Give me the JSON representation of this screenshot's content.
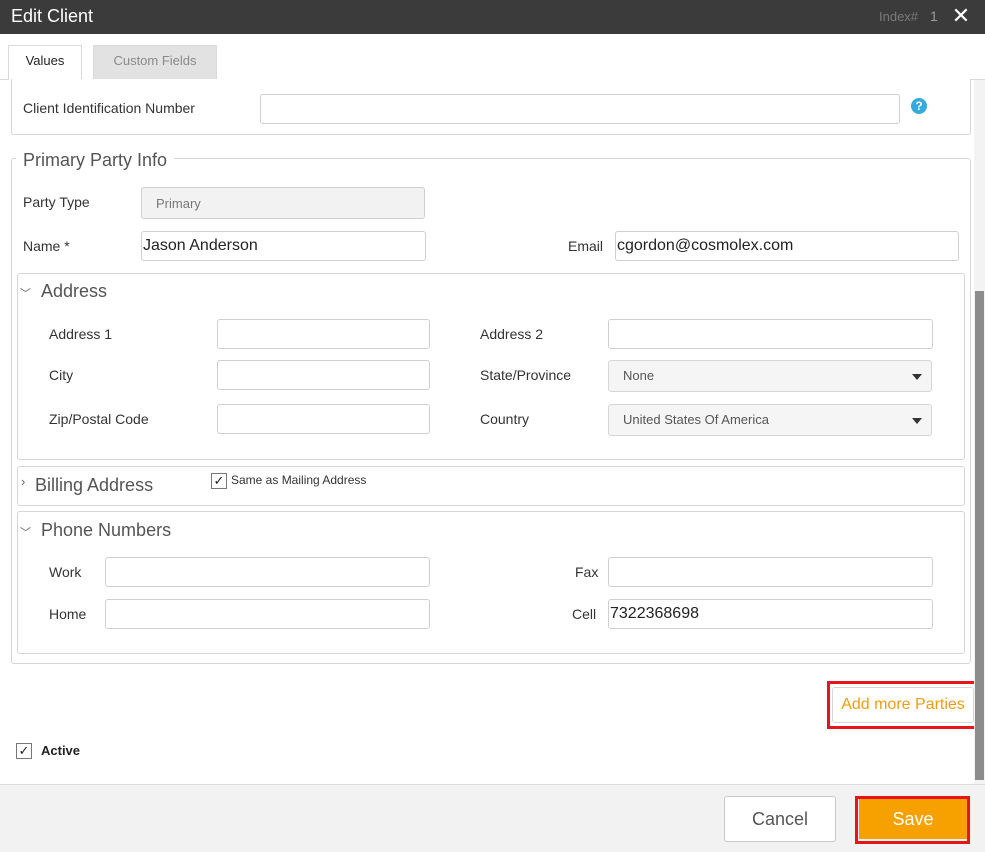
{
  "window": {
    "title": "Edit Client",
    "index_label": "Index#",
    "index_value": "1",
    "close_icon": "close-icon"
  },
  "tabs": [
    {
      "label": "Values",
      "active": true
    },
    {
      "label": "Custom Fields",
      "active": false
    }
  ],
  "client_id": {
    "label": "Client Identification Number",
    "value": "",
    "help_icon": "help-icon",
    "help_glyph": "?"
  },
  "primary_party": {
    "title": "Primary Party Info",
    "party_type_label": "Party Type",
    "party_type_value": "Primary",
    "name_label": "Name *",
    "name_value": "Jason Anderson",
    "email_label": "Email",
    "email_value": "cgordon@cosmolex.com"
  },
  "address": {
    "title": "Address",
    "address1_label": "Address 1",
    "address1_value": "",
    "address2_label": "Address 2",
    "address2_value": "",
    "city_label": "City",
    "city_value": "",
    "state_label": "State/Province",
    "state_value": "None",
    "zip_label": "Zip/Postal Code",
    "zip_value": "",
    "country_label": "Country",
    "country_value": "United States Of America"
  },
  "billing": {
    "title": "Billing Address",
    "same_as_mailing_label": "Same as Mailing Address",
    "same_as_mailing_checked": true
  },
  "phones": {
    "title": "Phone Numbers",
    "work_label": "Work",
    "work_value": "",
    "fax_label": "Fax",
    "fax_value": "",
    "home_label": "Home",
    "home_value": "",
    "cell_label": "Cell",
    "cell_value": "7322368698"
  },
  "add_parties_label": "Add more Parties",
  "active": {
    "label": "Active",
    "checked": true,
    "check_glyph": "✓"
  },
  "footer": {
    "cancel_label": "Cancel",
    "save_label": "Save"
  },
  "colors": {
    "titlebar": "#3b3b3b",
    "accent": "#f7a100",
    "link": "#f39c12",
    "highlight": "#e8141b",
    "help": "#35aadc"
  }
}
